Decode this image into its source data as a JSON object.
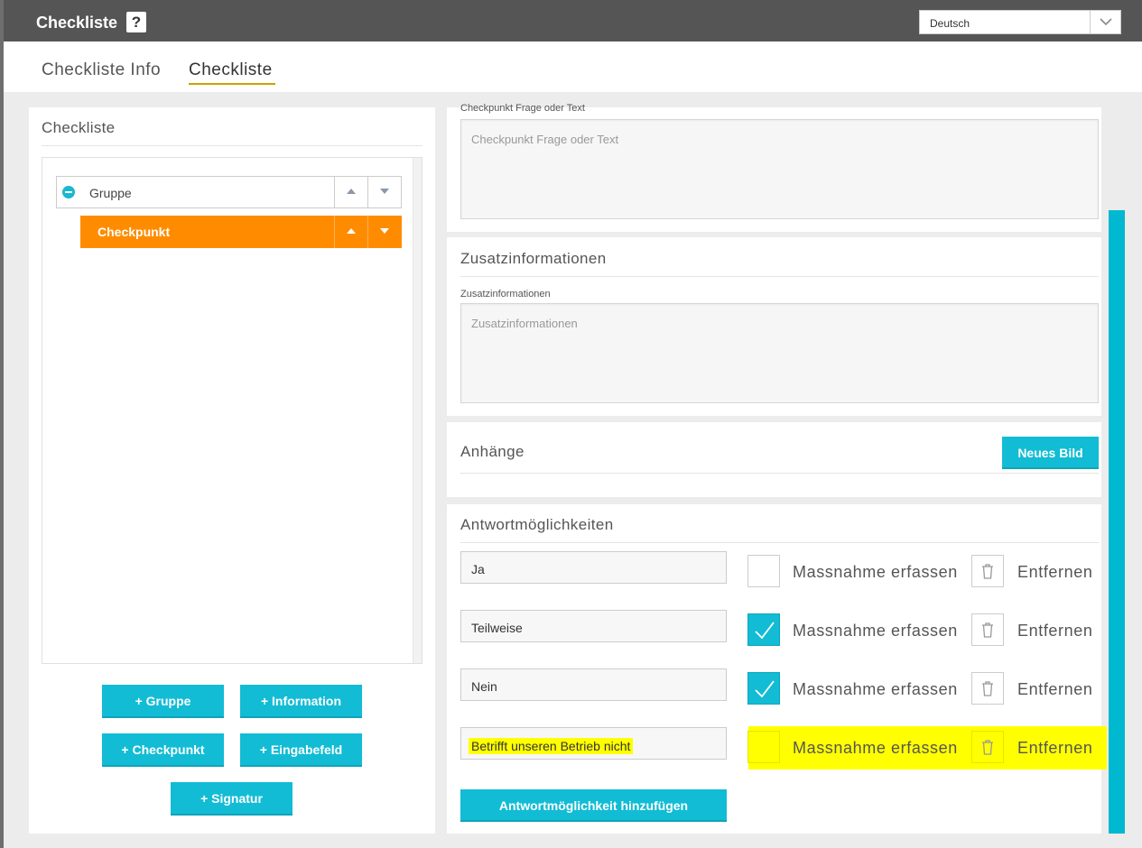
{
  "header": {
    "title": "Checkliste",
    "help_label": "?",
    "language": "Deutsch"
  },
  "tabs": [
    {
      "label": "Checkliste Info"
    },
    {
      "label": "Checkliste"
    }
  ],
  "left": {
    "title": "Checkliste",
    "tree": {
      "group_label": "Gruppe",
      "checkpoint_label": "Checkpunkt"
    },
    "buttons": {
      "gruppe": "+ Gruppe",
      "information": "+ Information",
      "checkpunkt": "+ Checkpunkt",
      "eingabefeld": "+ Eingabefeld",
      "signatur": "+ Signatur"
    }
  },
  "question": {
    "label": "Checkpunkt Frage oder Text",
    "placeholder": "Checkpunkt Frage oder Text"
  },
  "zusatz": {
    "title": "Zusatzinformationen",
    "label": "Zusatzinformationen",
    "placeholder": "Zusatzinformationen"
  },
  "anhaenge": {
    "title": "Anhänge",
    "new_image_button": "Neues Bild"
  },
  "answers": {
    "title": "Antwortmöglichkeiten",
    "items": [
      {
        "value": "Ja",
        "checked": false,
        "action_label": "Massnahme erfassen",
        "remove_label": "Entfernen"
      },
      {
        "value": "Teilweise",
        "checked": true,
        "action_label": "Massnahme erfassen",
        "remove_label": "Entfernen"
      },
      {
        "value": "Nein",
        "checked": true,
        "action_label": "Massnahme erfassen",
        "remove_label": "Entfernen"
      },
      {
        "value": "Betrifft unseren Betrieb nicht",
        "checked": false,
        "action_label": "Massnahme erfassen",
        "remove_label": "Entfernen"
      }
    ],
    "add_button": "Antwortmöglichkeit hinzufügen"
  },
  "colors": {
    "accent": "#12bcd4",
    "selected_item": "#ff8c00",
    "highlight": "#ffff00",
    "tab_underline": "#c8a200"
  }
}
